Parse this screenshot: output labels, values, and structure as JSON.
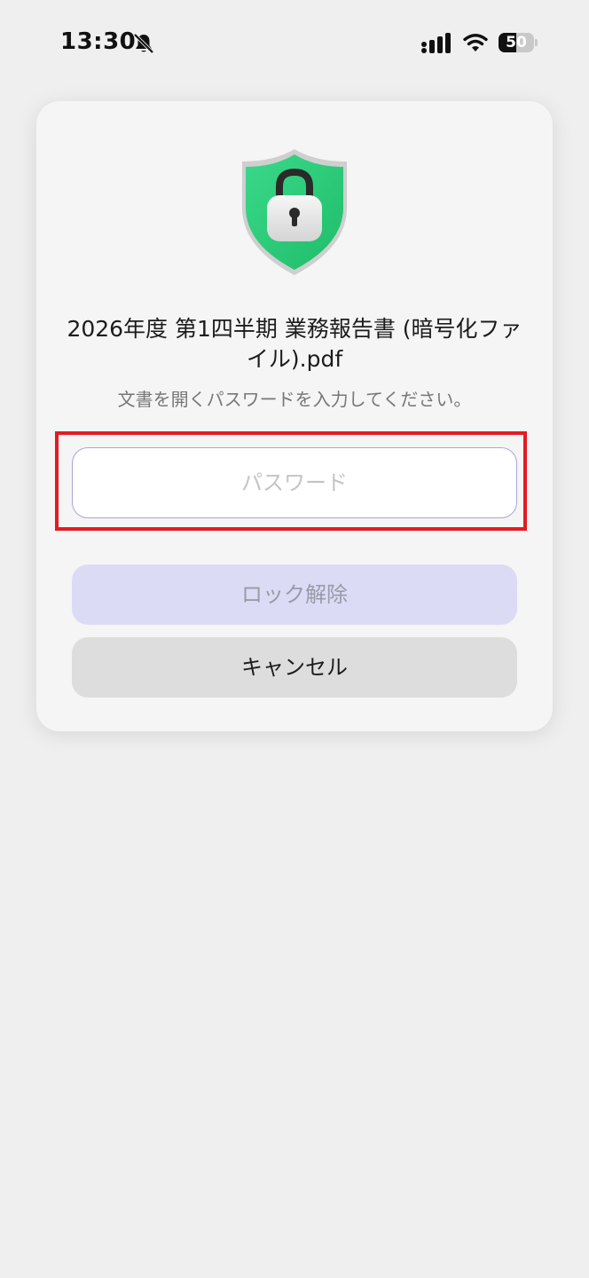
{
  "status_bar": {
    "time": "13:30",
    "battery_level": "50",
    "battery_fraction": 0.5,
    "icons": [
      "bell-slash-icon",
      "signal-icon",
      "wifi-icon",
      "battery-icon"
    ]
  },
  "dialog": {
    "icon": "shield-lock-icon",
    "title": "2026年度 第1四半期 業務報告書 (暗号化ファイル).pdf",
    "subtitle": "文書を開くパスワードを入力してください。",
    "password_placeholder": "パスワード",
    "password_value": "",
    "unlock_label": "ロック解除",
    "cancel_label": "キャンセル"
  },
  "colors": {
    "highlight": "#e31b23",
    "shield": "#2ecf7a",
    "unlock_disabled_bg": "#dcdbf6",
    "cancel_bg": "#dddddd"
  }
}
